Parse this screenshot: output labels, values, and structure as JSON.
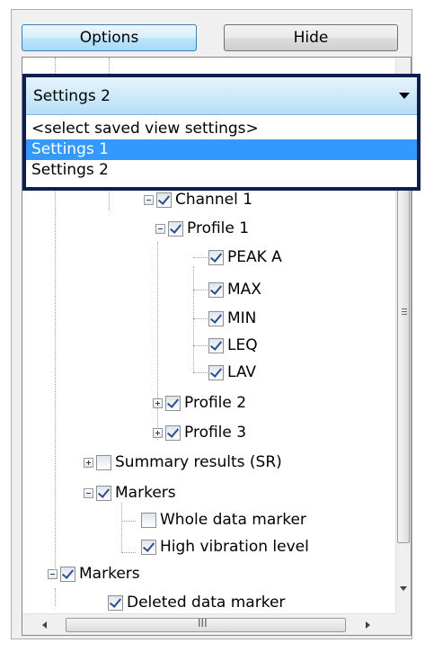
{
  "buttons": {
    "options_label": "Options",
    "hide_label": "Hide"
  },
  "view_settings": {
    "selected": "Settings 2",
    "options": [
      {
        "label": "<select saved view settings>",
        "highlighted": false
      },
      {
        "label": "Settings 1",
        "highlighted": true
      },
      {
        "label": "Settings 2",
        "highlighted": false
      }
    ]
  },
  "tree": {
    "items": [
      {
        "label": "Channel 1",
        "checked": true,
        "expander": "collapse"
      },
      {
        "label": "Profile 1",
        "checked": true,
        "expander": "collapse"
      },
      {
        "label": "PEAK A",
        "checked": true,
        "expander": "none"
      },
      {
        "label": "MAX",
        "checked": true,
        "expander": "none"
      },
      {
        "label": "MIN",
        "checked": true,
        "expander": "none"
      },
      {
        "label": "LEQ",
        "checked": true,
        "expander": "none"
      },
      {
        "label": "LAV",
        "checked": true,
        "expander": "none"
      },
      {
        "label": "Profile 2",
        "checked": true,
        "expander": "expand"
      },
      {
        "label": "Profile 3",
        "checked": true,
        "expander": "expand"
      },
      {
        "label": "Summary results (SR)",
        "checked": false,
        "expander": "expand"
      },
      {
        "label": "Markers",
        "checked": true,
        "expander": "collapse"
      },
      {
        "label": "Whole data marker",
        "checked": false,
        "expander": "none"
      },
      {
        "label": "High vibration level",
        "checked": true,
        "expander": "none"
      },
      {
        "label": "Markers",
        "checked": true,
        "expander": "collapse"
      },
      {
        "label": "Deleted data marker",
        "checked": true,
        "expander": "none"
      }
    ]
  },
  "scrollbars": {
    "horizontal_thumb_text": "III",
    "vertical_thumb_text": "≡"
  }
}
